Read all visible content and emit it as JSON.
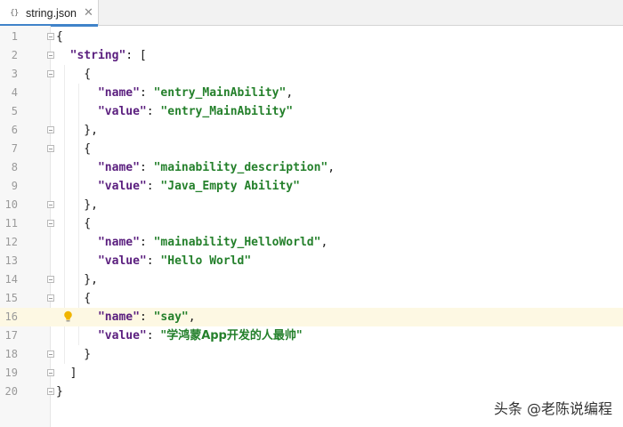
{
  "tab": {
    "icon": "{}",
    "filename": "string.json",
    "close": "✕"
  },
  "watermark": "头条 @老陈说编程",
  "colors": {
    "key": "#5a1e7e",
    "string": "#24802b",
    "current_line": "#fdf8e3",
    "tab_accent": "#4083c9"
  },
  "lines": [
    {
      "num": "1",
      "text": "{"
    },
    {
      "num": "2",
      "text": "  \"string\": ["
    },
    {
      "num": "3",
      "text": "    {"
    },
    {
      "num": "4",
      "text": "      \"name\": \"entry_MainAbility\","
    },
    {
      "num": "5",
      "text": "      \"value\": \"entry_MainAbility\""
    },
    {
      "num": "6",
      "text": "    },"
    },
    {
      "num": "7",
      "text": "    {"
    },
    {
      "num": "8",
      "text": "      \"name\": \"mainability_description\","
    },
    {
      "num": "9",
      "text": "      \"value\": \"Java_Empty Ability\""
    },
    {
      "num": "10",
      "text": "    },"
    },
    {
      "num": "11",
      "text": "    {"
    },
    {
      "num": "12",
      "text": "      \"name\": \"mainability_HelloWorld\","
    },
    {
      "num": "13",
      "text": "      \"value\": \"Hello World\""
    },
    {
      "num": "14",
      "text": "    },"
    },
    {
      "num": "15",
      "text": "    {"
    },
    {
      "num": "16",
      "text": "      \"name\": \"say\","
    },
    {
      "num": "17",
      "text": "      \"value\": \"学鸿蒙App开发的人最帅\""
    },
    {
      "num": "18",
      "text": "    }"
    },
    {
      "num": "19",
      "text": "  ]"
    },
    {
      "num": "20",
      "text": "}"
    }
  ],
  "current_line": "16",
  "fold_lines": [
    "1",
    "2",
    "3",
    "6",
    "7",
    "10",
    "11",
    "14",
    "15",
    "18",
    "19",
    "20"
  ],
  "icons": {
    "file": "json-file-icon",
    "close": "close-icon",
    "fold": "fold-marker-icon",
    "intention": "lightbulb-icon"
  }
}
